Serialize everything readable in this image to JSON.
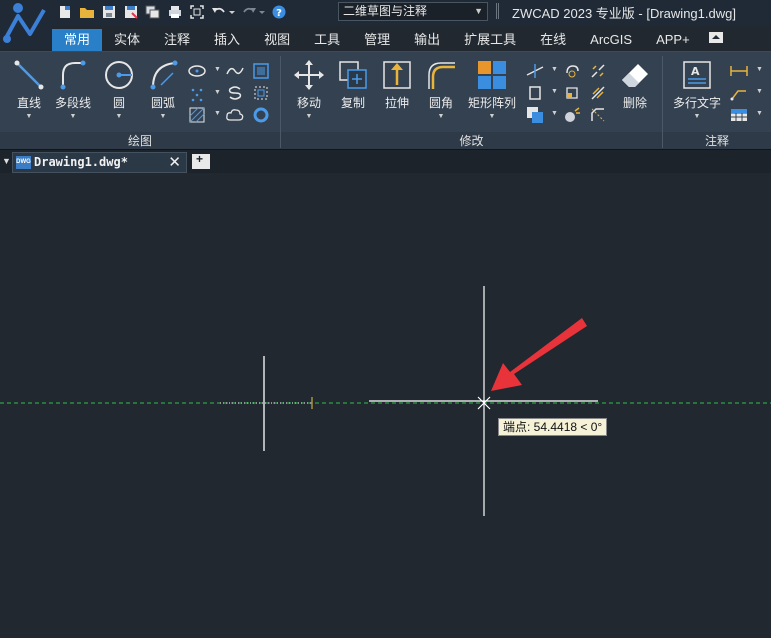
{
  "app": {
    "title": "ZWCAD 2023 专业版 - [Drawing1.dwg]",
    "workspace": "二维草图与注释"
  },
  "quick_access": {
    "icons": [
      "new-icon",
      "open-icon",
      "save-icon",
      "save-as-icon",
      "sheet-set-icon",
      "print-icon",
      "zoom-extents-icon",
      "undo-icon",
      "redo-icon",
      "help-icon"
    ]
  },
  "tabs": [
    {
      "label": "常用",
      "active": true
    },
    {
      "label": "实体",
      "active": false
    },
    {
      "label": "注释",
      "active": false
    },
    {
      "label": "插入",
      "active": false
    },
    {
      "label": "视图",
      "active": false
    },
    {
      "label": "工具",
      "active": false
    },
    {
      "label": "管理",
      "active": false
    },
    {
      "label": "输出",
      "active": false
    },
    {
      "label": "扩展工具",
      "active": false
    },
    {
      "label": "在线",
      "active": false
    },
    {
      "label": "ArcGIS",
      "active": false
    },
    {
      "label": "APP+",
      "active": false
    }
  ],
  "ribbon": {
    "draw": {
      "title": "绘图",
      "buttons": [
        {
          "label": "直线",
          "icon": "line-icon"
        },
        {
          "label": "多段线",
          "icon": "polyline-icon"
        },
        {
          "label": "圆",
          "icon": "circle-icon"
        },
        {
          "label": "圆弧",
          "icon": "arc-icon"
        }
      ]
    },
    "modify": {
      "title": "修改",
      "buttons": [
        {
          "label": "移动",
          "icon": "move-icon"
        },
        {
          "label": "复制",
          "icon": "copy-icon"
        },
        {
          "label": "拉伸",
          "icon": "stretch-icon"
        },
        {
          "label": "圆角",
          "icon": "fillet-icon"
        },
        {
          "label": "矩形阵列",
          "icon": "rect-array-icon"
        },
        {
          "label": "删除",
          "icon": "erase-icon"
        }
      ]
    },
    "annotate": {
      "title": "注释",
      "buttons": [
        {
          "label": "多行文字",
          "icon": "mtext-icon"
        }
      ]
    }
  },
  "document": {
    "tab_label": "Drawing1.dwg*",
    "file_icon_text": "DWG"
  },
  "canvas": {
    "tooltip": "端点: 54.4418 < 0°",
    "colors": {
      "background": "#212830",
      "crosshair": "#ffffff",
      "tracking_line": "#2fbf4a",
      "arrow": "#e8333a"
    }
  }
}
